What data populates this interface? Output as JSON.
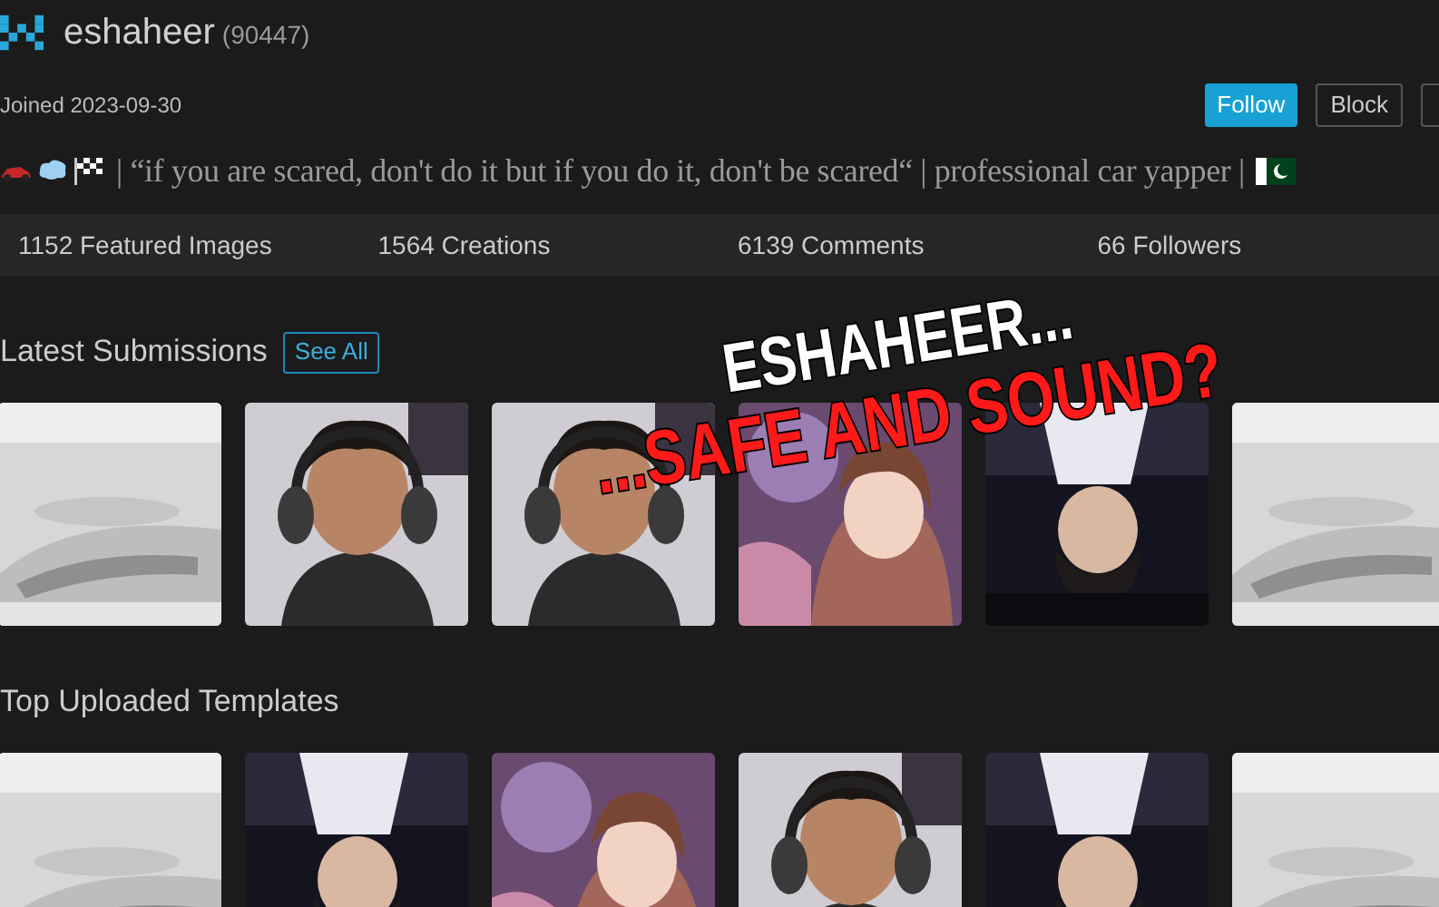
{
  "profile": {
    "username": "eshaheer",
    "points": "(90447)",
    "joined": "Joined 2023-09-30",
    "bio": "| “if you are scared, don't do it but if you do it, don't be scared“ | professional car yapper |"
  },
  "actions": [
    "Follow",
    "Block"
  ],
  "stats": [
    "1152 Featured Images",
    "1564 Creations",
    "6139 Comments",
    "66 Followers"
  ],
  "sections": [
    {
      "title": "Latest Submissions",
      "button": "See All"
    },
    {
      "title": "Top Uploaded Templates"
    }
  ],
  "overlay": {
    "line_1": "ESHAHEER...",
    "line_2": "...SAFE AND SOUND?"
  }
}
